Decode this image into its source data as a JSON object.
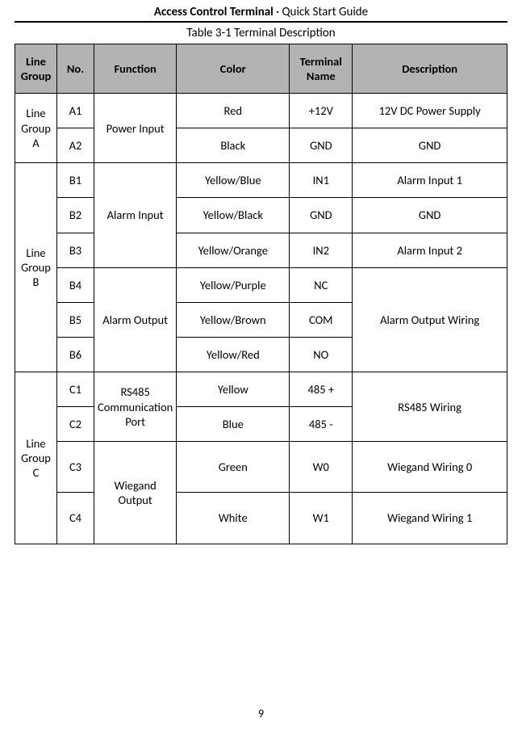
{
  "header": {
    "bold": "Access Control Terminal",
    "sep": "·",
    "light": "Quick Start Guide"
  },
  "caption": {
    "label": "Table 3-1",
    "text": "Terminal Description"
  },
  "th": {
    "group": "Line Group",
    "no": "No.",
    "func": "Function",
    "color": "Color",
    "term": "Terminal Name",
    "desc": "Description"
  },
  "rows": {
    "a": {
      "group": "Line Group A",
      "r1": {
        "no": "A1",
        "func": "Power Input",
        "color": "Red",
        "term": "+12V",
        "desc": "12V DC Power Supply"
      },
      "r2": {
        "no": "A2",
        "color": "Black",
        "term": "GND",
        "desc": "GND"
      }
    },
    "b": {
      "group": "Line Group B",
      "r1": {
        "no": "B1",
        "func": "Alarm Input",
        "color": "Yellow/Blue",
        "term": "IN1",
        "desc": "Alarm Input 1"
      },
      "r2": {
        "no": "B2",
        "color": "Yellow/Black",
        "term": "GND",
        "desc": "GND"
      },
      "r3": {
        "no": "B3",
        "color": "Yellow/Orange",
        "term": "IN2",
        "desc": "Alarm Input 2"
      },
      "r4": {
        "no": "B4",
        "func": "Alarm Output",
        "color": "Yellow/Purple",
        "term": "NC",
        "desc": "Alarm Output Wiring"
      },
      "r5": {
        "no": "B5",
        "color": "Yellow/Brown",
        "term": "COM"
      },
      "r6": {
        "no": "B6",
        "color": "Yellow/Red",
        "term": "NO"
      }
    },
    "c": {
      "group": "Line Group C",
      "r1": {
        "no": "C1",
        "func": "RS485 Communication Port",
        "color": "Yellow",
        "term": "485 +",
        "desc": "RS485 Wiring"
      },
      "r2": {
        "no": "C2",
        "color": "Blue",
        "term": "485 -"
      },
      "r3": {
        "no": "C3",
        "func": "Wiegand Output",
        "color": "Green",
        "term": "W0",
        "desc": "Wiegand Wiring 0"
      },
      "r4": {
        "no": "C4",
        "color": "White",
        "term": "W1",
        "desc": "Wiegand Wiring 1"
      }
    }
  },
  "page_number": "9"
}
